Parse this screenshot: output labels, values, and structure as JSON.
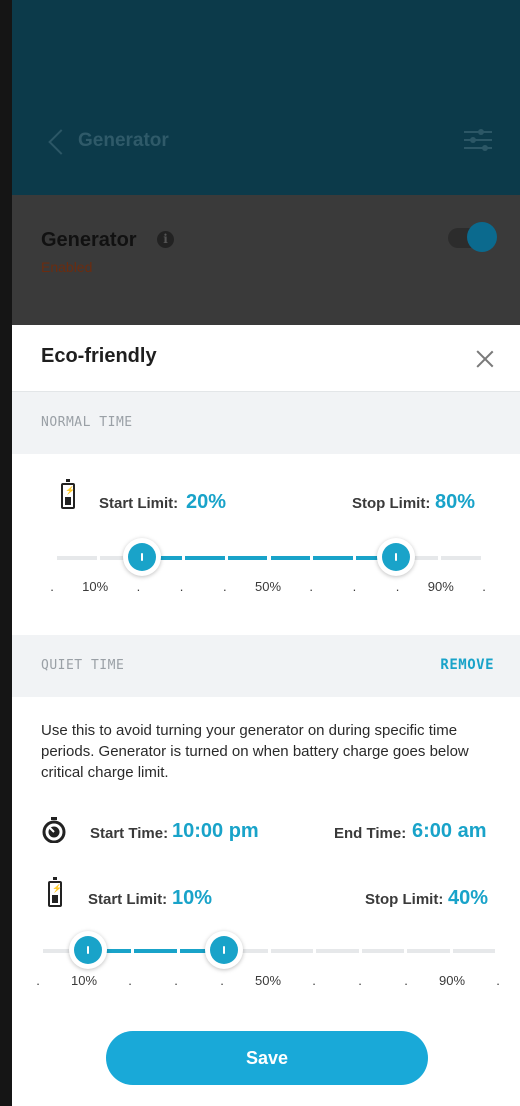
{
  "header": {
    "title": "Generator"
  },
  "background_card": {
    "title": "Generator",
    "info_icon": "i",
    "status": "Enabled",
    "toggle_on": true
  },
  "sheet": {
    "title": "Eco-friendly",
    "normal_time": {
      "section_label": "NORMAL TIME",
      "start_limit_label": "Start Limit:",
      "start_limit_value": "20%",
      "stop_limit_label": "Stop Limit:",
      "stop_limit_value": "80%",
      "start_percent": 20,
      "stop_percent": 80,
      "tick_labels": [
        ".",
        "10%",
        ".",
        ".",
        ".",
        "50%",
        ".",
        ".",
        ".",
        "90%",
        "."
      ]
    },
    "quiet_time": {
      "section_label": "QUIET TIME",
      "remove_label": "REMOVE",
      "description": "Use this to avoid turning your generator on during specific time periods. Generator is turned on when battery charge goes below critical charge limit.",
      "start_time_label": "Start Time:",
      "start_time_value": "10:00 pm",
      "end_time_label": "End Time:",
      "end_time_value": "6:00 am",
      "start_limit_label": "Start Limit:",
      "start_limit_value": "10%",
      "stop_limit_label": "Stop Limit:",
      "stop_limit_value": "40%",
      "start_percent": 10,
      "stop_percent": 40,
      "tick_labels": [
        ".",
        "10%",
        ".",
        ".",
        ".",
        "50%",
        ".",
        ".",
        ".",
        "90%",
        "."
      ]
    },
    "save_label": "Save"
  },
  "colors": {
    "accent": "#19a3c9",
    "header_dim": "#0c3a4a",
    "track_inactive": "#e6e8ea"
  }
}
